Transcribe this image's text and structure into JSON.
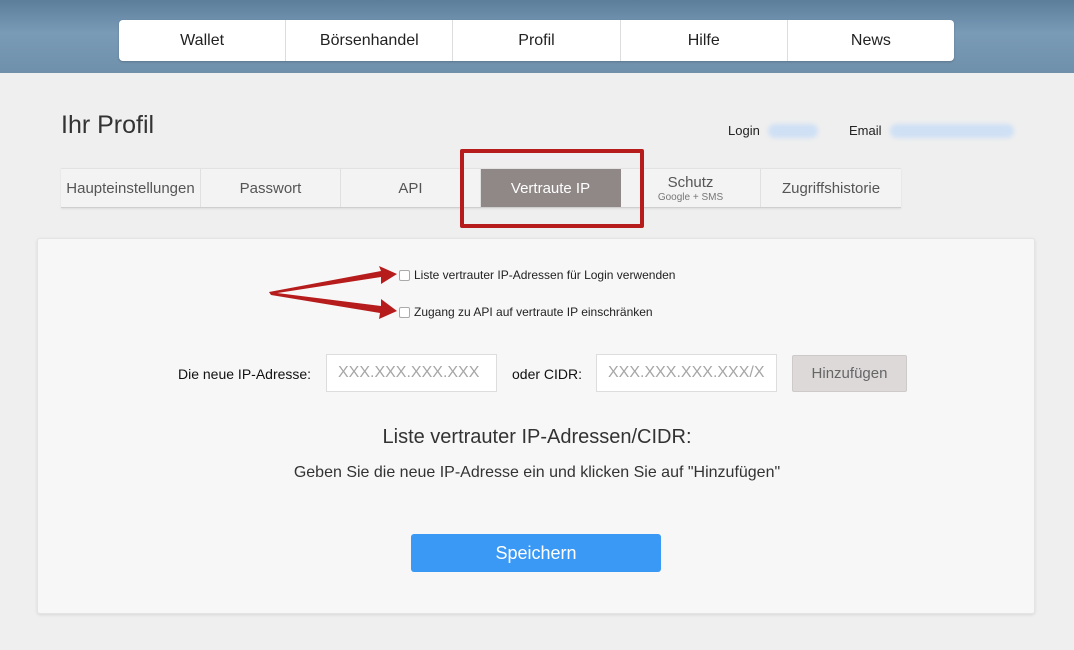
{
  "nav": {
    "items": [
      {
        "label": "Wallet"
      },
      {
        "label": "Börsenhandel"
      },
      {
        "label": "Profil"
      },
      {
        "label": "Hilfe"
      },
      {
        "label": "News"
      }
    ]
  },
  "profile": {
    "title": "Ihr Profil",
    "login_label": "Login",
    "email_label": "Email"
  },
  "tabs": [
    {
      "label": "Haupteinstellungen",
      "sub": ""
    },
    {
      "label": "Passwort",
      "sub": ""
    },
    {
      "label": "API",
      "sub": ""
    },
    {
      "label": "Vertraute IP",
      "sub": ""
    },
    {
      "label": "Schutz",
      "sub": "Google + SMS"
    },
    {
      "label": "Zugriffshistorie",
      "sub": ""
    }
  ],
  "active_tab": "Vertraute IP",
  "options": {
    "use_for_login": {
      "label": "Liste vertrauter IP-Adressen für Login verwenden",
      "checked": false
    },
    "restrict_api": {
      "label": "Zugang zu API auf vertraute IP einschränken",
      "checked": false
    }
  },
  "ip_form": {
    "ip_label": "Die neue IP-Adresse:",
    "ip_placeholder": "XXX.XXX.XXX.XXX",
    "cidr_label": "oder CIDR:",
    "cidr_placeholder": "XXX.XXX.XXX.XXX/XX",
    "add_button": "Hinzufügen"
  },
  "list": {
    "title": "Liste vertrauter IP-Adressen/CIDR:",
    "hint": "Geben Sie die neue IP-Adresse ein und klicken Sie auf \"Hinzufügen\""
  },
  "save_button": "Speichern",
  "colors": {
    "accent_blue": "#3a99f5",
    "active_tab": "#8f8887",
    "annotation_red": "#b71c1c"
  }
}
